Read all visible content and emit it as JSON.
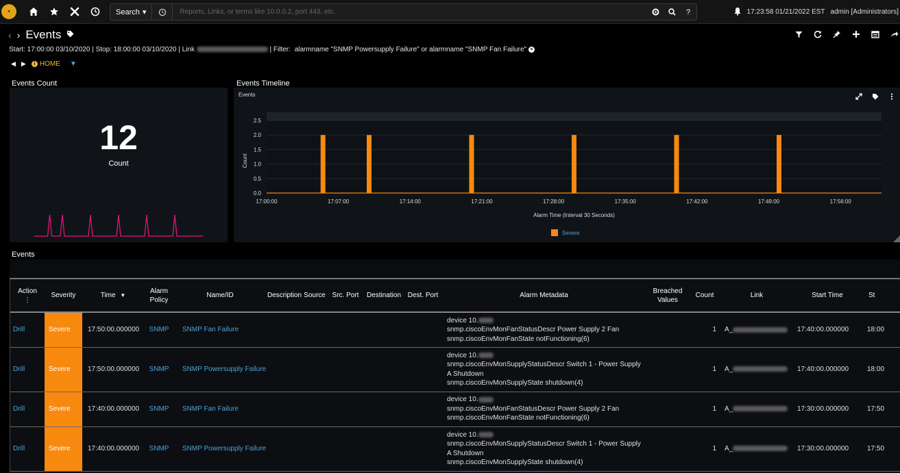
{
  "topbar": {
    "search_label": "Search",
    "search_placeholder": "Reports, Links, or terms like 10.0.0.2, port 443, etc.",
    "clock": "17:23:58 01/21/2022 EST",
    "user": "admin [Administrators]"
  },
  "header": {
    "title": "Events",
    "info_prefix": "Start: 17:00:00 03/10/2020 | Stop: 18:00:00 03/10/2020 | Link",
    "info_filter_label": "| Filter:",
    "info_filter_value": "alarmname \"SNMP Powersupply Failure\" or alarmname \"SNMP Fan Failure\"",
    "home_label": "HOME"
  },
  "count_panel": {
    "title": "Events Count",
    "value": "12",
    "label": "Count"
  },
  "timeline_panel": {
    "title": "Events Timeline",
    "inner_title": "Events"
  },
  "chart_data": {
    "type": "bar",
    "ylabel": "Count",
    "xlabel": "Alarm Time (Interval 30 Seconds)",
    "yticks": [
      "0.0",
      "0.5",
      "1.0",
      "1.5",
      "2.0",
      "2.5"
    ],
    "ylim": [
      0,
      2.5
    ],
    "xticks": [
      "17:00:00",
      "17:07:00",
      "17:14:00",
      "17:21:00",
      "17:28:00",
      "17:35:00",
      "17:42:00",
      "17:49:00",
      "17:56:00"
    ],
    "x_range_minutes": [
      0,
      60
    ],
    "bars": [
      {
        "minute": 5.5,
        "value": 2
      },
      {
        "minute": 10.0,
        "value": 2
      },
      {
        "minute": 20.0,
        "value": 2
      },
      {
        "minute": 30.0,
        "value": 2
      },
      {
        "minute": 40.0,
        "value": 2
      },
      {
        "minute": 50.0,
        "value": 2
      }
    ],
    "series": [
      {
        "name": "Severe",
        "color": "#f7890f"
      }
    ],
    "sparkline_color": "#e0157a"
  },
  "table": {
    "title": "Events",
    "columns": [
      "Action",
      "Severity",
      "Time",
      "Alarm Policy",
      "Name/ID",
      "Description",
      "Source",
      "Src. Port",
      "Destination",
      "Dest. Port",
      "Alarm Metadata",
      "Breached Values",
      "Count",
      "Link",
      "Start Time",
      "St"
    ],
    "rows": [
      {
        "action": "Drill",
        "severity": "Severe",
        "time": "17:50:00.000000",
        "policy": "SNMP",
        "name": "SNMP Fan Failure",
        "meta1": "device 10.",
        "meta2": "snmp.ciscoEnvMonFanStatusDescr Power Supply 2 Fan",
        "meta3": "snmp.ciscoEnvMonFanState notFunctioning(6)",
        "count": "1",
        "link": "A_",
        "start": "17:40:00.000000",
        "stop": "18:00"
      },
      {
        "action": "Drill",
        "severity": "Severe",
        "time": "17:50:00.000000",
        "policy": "SNMP",
        "name": "SNMP Powersupply Failure",
        "meta1": "device 10.",
        "meta2": "snmp.ciscoEnvMonSupplyStatusDescr Switch 1 - Power Supply A Shutdown",
        "meta3": "snmp.ciscoEnvMonSupplyState shutdown(4)",
        "count": "1",
        "link": "A_",
        "start": "17:40:00.000000",
        "stop": "18:00"
      },
      {
        "action": "Drill",
        "severity": "Severe",
        "time": "17:40:00.000000",
        "policy": "SNMP",
        "name": "SNMP Fan Failure",
        "meta1": "device 10.",
        "meta2": "snmp.ciscoEnvMonFanStatusDescr Power Supply 2 Fan",
        "meta3": "snmp.ciscoEnvMonFanState notFunctioning(6)",
        "count": "1",
        "link": "A_",
        "start": "17:30:00.000000",
        "stop": "17:50"
      },
      {
        "action": "Drill",
        "severity": "Severe",
        "time": "17:40:00.000000",
        "policy": "SNMP",
        "name": "SNMP Powersupply Failure",
        "meta1": "device 10.",
        "meta2": "snmp.ciscoEnvMonSupplyStatusDescr Switch 1 - Power Supply A Shutdown",
        "meta3": "snmp.ciscoEnvMonSupplyState shutdown(4)",
        "count": "1",
        "link": "A_",
        "start": "17:30:00.000000",
        "stop": "17:50"
      }
    ]
  }
}
